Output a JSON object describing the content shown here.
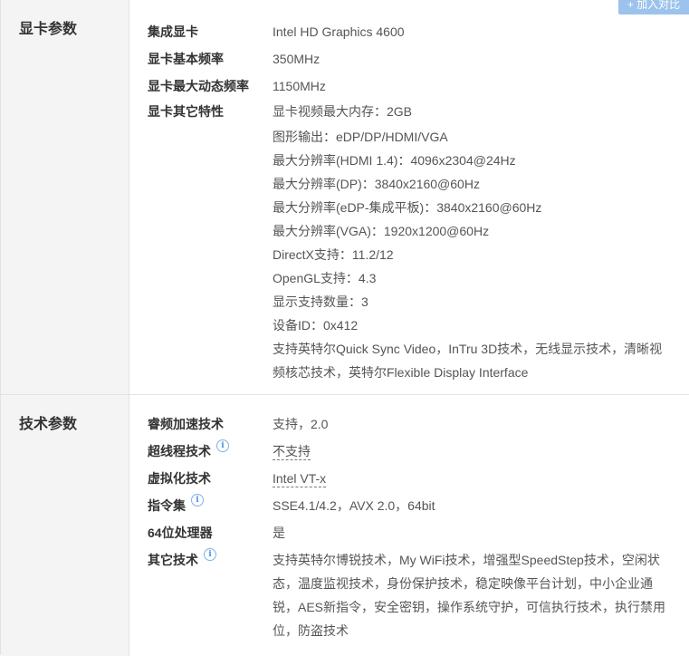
{
  "compare_button": "+ 加入对比",
  "graphics": {
    "title": "显卡参数",
    "rows": [
      {
        "label": "集成显卡",
        "value": "Intel HD Graphics 4600"
      },
      {
        "label": "显卡基本频率",
        "value": "350MHz"
      },
      {
        "label": "显卡最大动态频率",
        "value": "1150MHz"
      }
    ],
    "other_label": "显卡其它特性",
    "other_lines": [
      "显卡视频最大内存：2GB",
      "图形输出：eDP/DP/HDMI/VGA",
      "最大分辨率(HDMI 1.4)：4096x2304@24Hz",
      "最大分辨率(DP)：3840x2160@60Hz",
      "最大分辨率(eDP-集成平板)：3840x2160@60Hz",
      "最大分辨率(VGA)：1920x1200@60Hz",
      "DirectX支持：11.2/12",
      "OpenGL支持：4.3",
      "显示支持数量：3",
      "设备ID：0x412",
      "支持英特尔Quick Sync Video，InTru 3D技术，无线显示技术，清晰视",
      "频核芯技术，英特尔Flexible Display Interface"
    ]
  },
  "tech": {
    "title": "技术参数",
    "rows": [
      {
        "label": "睿频加速技术",
        "value": "支持，2.0"
      },
      {
        "label": "超线程技术",
        "value": "不支持"
      },
      {
        "label": "虚拟化技术",
        "value": "Intel VT-x"
      },
      {
        "label": "指令集",
        "value": "SSE4.1/4.2，AVX 2.0，64bit"
      },
      {
        "label": "64位处理器",
        "value": "是"
      }
    ],
    "other_label": "其它技术",
    "other_lines": [
      "支持英特尔博锐技术，My WiFi技术，增强型SpeedStep技术，空闲状",
      "态，温度监视技术，身份保护技术，稳定映像平台计划，中小企业通",
      "锐，AES新指令，安全密钥，操作系统守护，可信执行技术，执行禁用",
      "位，防盗技术"
    ]
  },
  "icons": {
    "info": "info-icon",
    "plus": "plus-icon"
  },
  "colors": {
    "accent": "#4a90e2",
    "sidebar_bg": "#f4f4f4",
    "compare_bg": "#9cc3ec"
  }
}
